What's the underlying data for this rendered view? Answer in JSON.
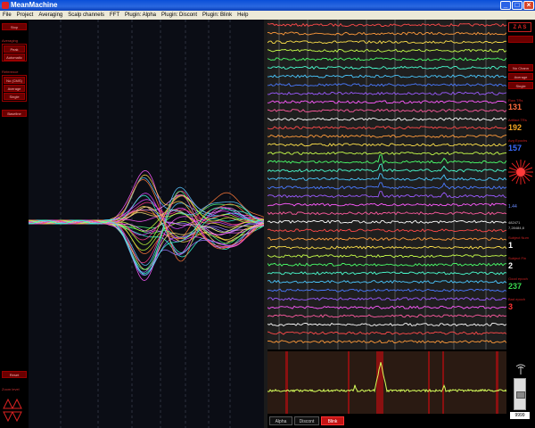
{
  "window": {
    "title": "MeanMachine"
  },
  "menu": [
    "File",
    "Project",
    "Averaging",
    "Scalp channels",
    "FFT",
    "Plugin: Alpha",
    "Plugin: Discont",
    "Plugin: Blink",
    "Help"
  ],
  "left_panel": {
    "top_button": "Stop",
    "group1_label": "Averaging",
    "group1_buttons": [
      "Peak",
      "Automatic"
    ],
    "group2_label": "Reference",
    "group2_buttons": [
      "No (CMS)",
      "Average",
      "Single"
    ],
    "mid_button": "Baseline",
    "bottom_button": "Reset",
    "bottom_label": "Zoom level"
  },
  "right_panel": {
    "top_letters": "Z A S",
    "buttons": [
      "No Chann",
      "Average",
      "Single"
    ],
    "stats": [
      {
        "label": "Raw TRs",
        "value": "131",
        "color": "#ff6b3d"
      },
      {
        "label": "Artifact TRs",
        "value": "192",
        "color": "#f5a623"
      },
      {
        "label": "Avg Epochs",
        "value": "157",
        "color": "#3a6bff"
      }
    ],
    "readouts": [
      "1.44",
      "482471",
      "7,28484,8"
    ],
    "stats2": [
      {
        "label": "Subject Num",
        "value": "1",
        "color": "#ffffff"
      },
      {
        "label": "Subject Fin",
        "value": "2",
        "color": "#ffffff"
      },
      {
        "label": "Good epoch",
        "value": "237",
        "color": "#3ad84f"
      },
      {
        "label": "Bad epoch",
        "value": "3",
        "color": "#ff3333"
      }
    ],
    "slider_value": "9999"
  },
  "tabs": [
    "Alpha",
    "Discont",
    "Blink"
  ],
  "active_tab": "Blink"
}
